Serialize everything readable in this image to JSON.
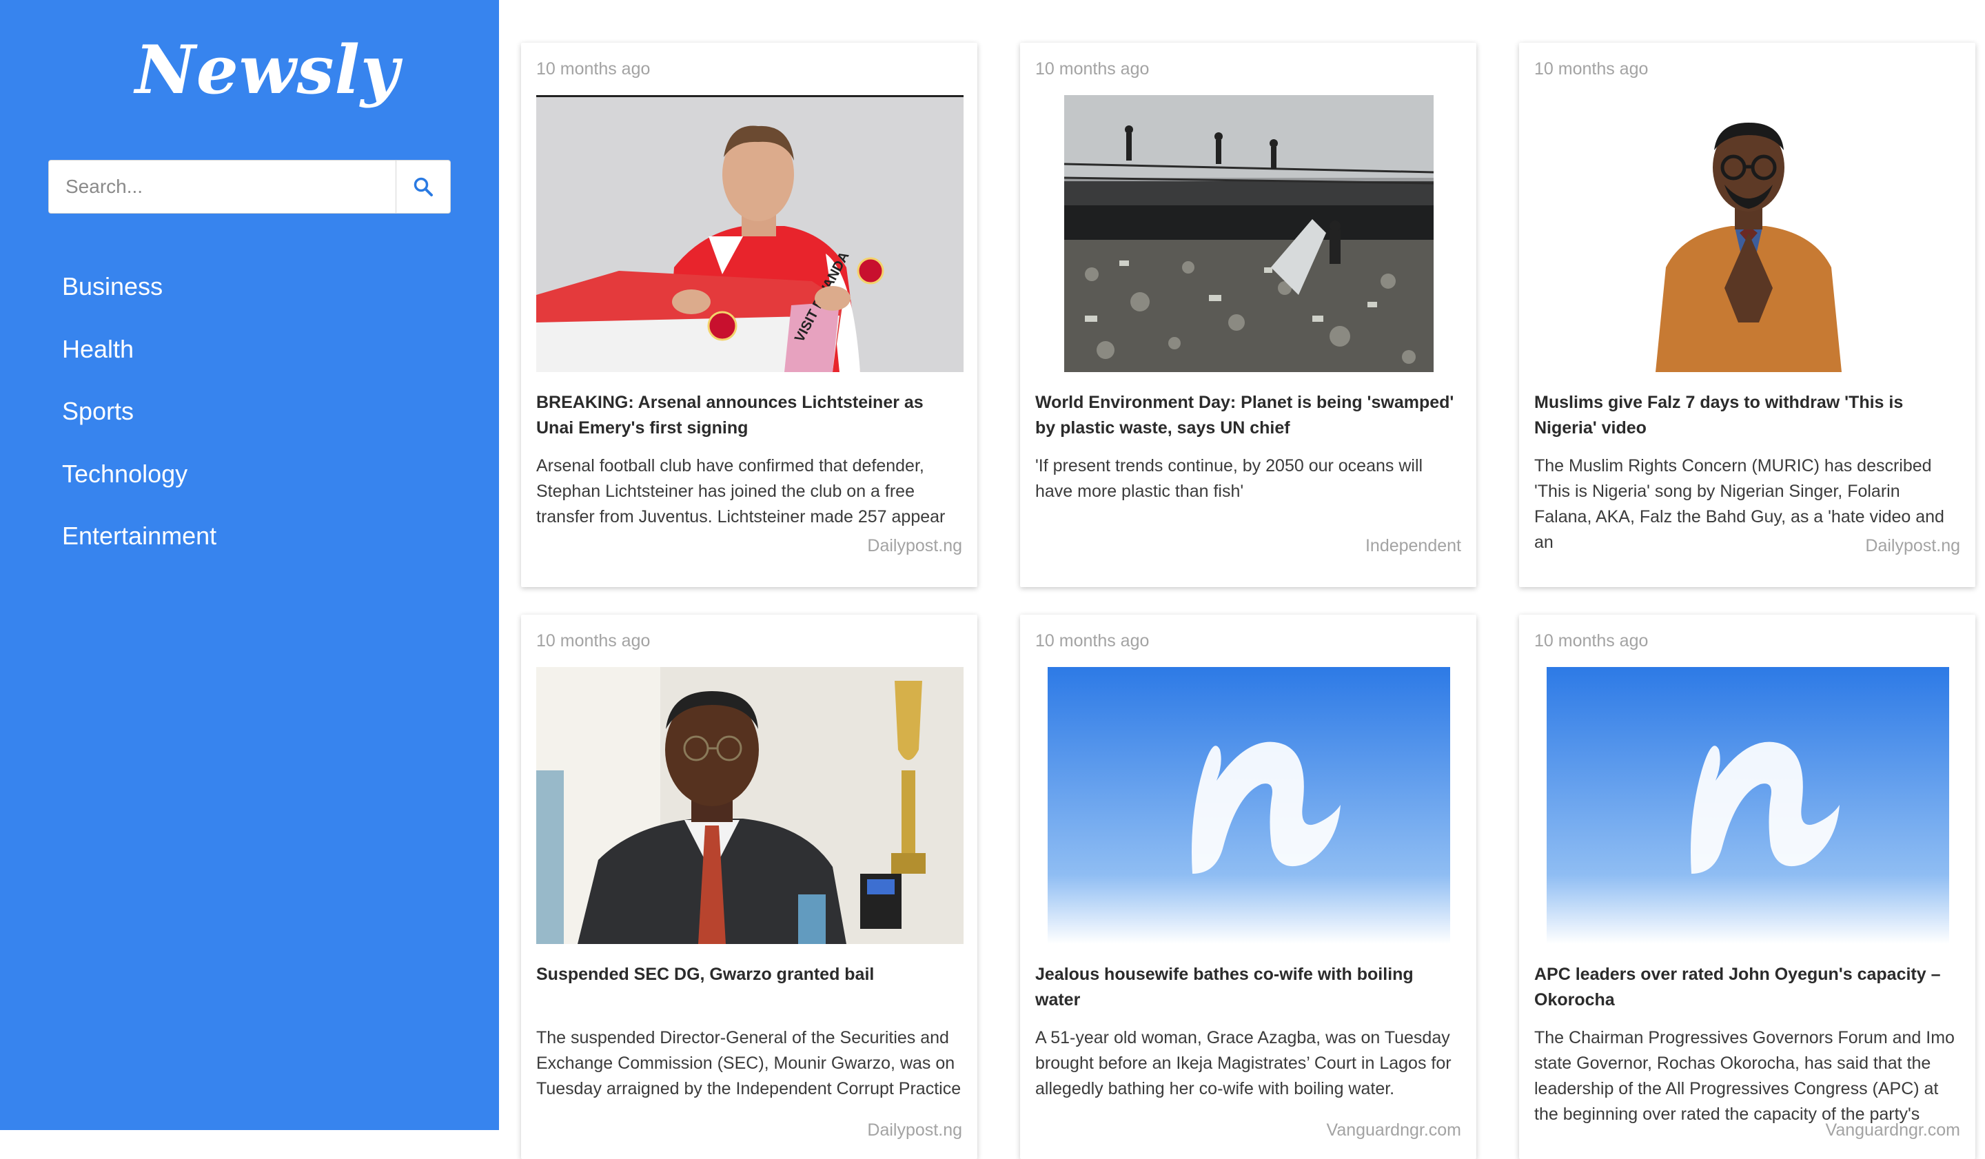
{
  "app": {
    "logo": "Newsly"
  },
  "search": {
    "placeholder": "Search..."
  },
  "nav": {
    "items": [
      "Business",
      "Health",
      "Sports",
      "Technology",
      "Entertainment"
    ]
  },
  "articles": [
    {
      "time": "10 months ago",
      "title": "BREAKING: Arsenal announces Lichtsteiner as Unai Emery's first signing",
      "description": "Arsenal football club have confirmed that defender, Stephan Lichtsteiner has joined the club on a free transfer from Juventus. Lichtsteiner made 257 appear",
      "source": "Dailypost.ng",
      "image_text": "VISIT RWANDA"
    },
    {
      "time": "10 months ago",
      "title": "World Environment Day: Planet is being 'swamped' by plastic waste, says UN chief",
      "description": "'If present trends continue, by 2050 our oceans will have more plastic than fish'",
      "source": "Independent"
    },
    {
      "time": "10 months ago",
      "title": "Muslims give Falz 7 days to withdraw 'This is Nigeria' video",
      "description": "The Muslim Rights Concern (MURIC) has described 'This is Nigeria' song by Nigerian Singer, Folarin Falana, AKA, Falz the Bahd Guy, as a 'hate video and an",
      "source": "Dailypost.ng"
    },
    {
      "time": "10 months ago",
      "title": "Suspended SEC DG, Gwarzo granted bail",
      "description": "The suspended Director-General of the Securities and Exchange Commission (SEC), Mounir Gwarzo, was on Tuesday arraigned by the Independent Corrupt Practice",
      "source": "Dailypost.ng"
    },
    {
      "time": "10 months ago",
      "title": "Jealous housewife bathes co-wife with boiling water",
      "description": "A 51-year old woman, Grace Azagba, was on Tuesday brought before an Ikeja Magistrates’ Court in Lagos for allegedly bathing her co-wife with boiling water.",
      "source": "Vanguardngr.com"
    },
    {
      "time": "10 months ago",
      "title": "APC leaders over rated John Oyegun's capacity – Okorocha",
      "description": "The Chairman Progressives Governors Forum and Imo state Governor, Rochas Okorocha, has said that the leadership of the All Progressives Congress (APC) at the beginning over rated the capacity of the party's",
      "source": "Vanguardngr.com"
    }
  ],
  "colors": {
    "sidebar": "#3784ee",
    "accent": "#2a7ae2"
  },
  "icons": {
    "search": "search-icon"
  }
}
